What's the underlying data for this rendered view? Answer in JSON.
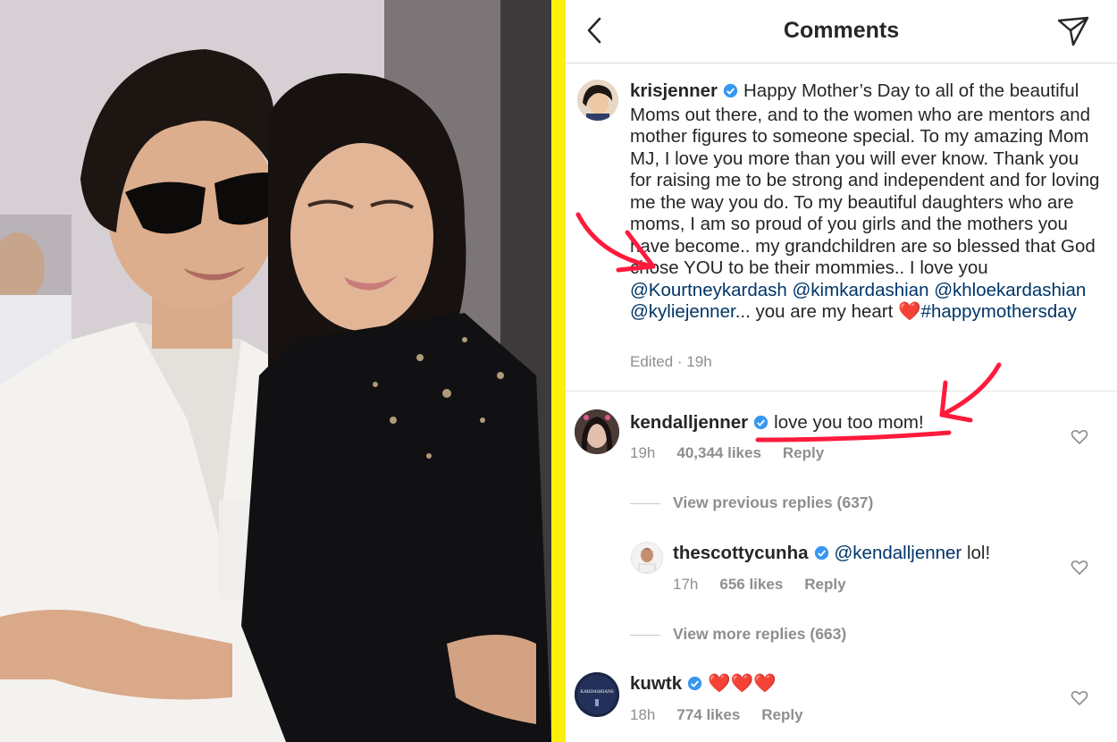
{
  "header": {
    "title": "Comments"
  },
  "caption": {
    "username": "krisjenner",
    "text_before_links": "Happy Mother’s Day to all of the beautiful Moms out there, and to the women who are mentors and mother figures to someone special. To my amazing Mom MJ, I love you more than you will ever know. Thank you for raising me to be strong and independent and for loving me the way you do. To my beautiful daughters who are moms, I am so proud of you girls and the mothers you have become.. my grandchildren are so blessed that God chose YOU to be their mommies.. I love you",
    "mentions": [
      "@Kourtneykardash",
      "@kimkardashian",
      "@khloekardashian",
      "@kyliejenner"
    ],
    "ellipsis": "...",
    "text_after_links": "you are my heart",
    "emoji": "❤️",
    "hashtag": "#happymothersday",
    "edited": "Edited · 19h"
  },
  "comments": [
    {
      "username": "kendalljenner",
      "text": "love you too mom!",
      "time": "19h",
      "likes": "40,344 likes",
      "reply": "Reply"
    }
  ],
  "view_previous_replies": "View previous replies (637)",
  "reply_comment": {
    "username": "thescottycunha",
    "mention": "@kendalljenner",
    "text": "lol!",
    "time": "17h",
    "likes": "656 likes",
    "reply": "Reply"
  },
  "view_more_replies": "View more replies (663)",
  "last_comment": {
    "username": "kuwtk",
    "text": "❤️❤️❤️",
    "time": "18h",
    "likes": "774 likes",
    "reply": "Reply",
    "avatar_label": "KARDASHIANS"
  },
  "colors": {
    "divider": "#fbf00a",
    "verified": "#3897f0",
    "link": "#003569",
    "annotation": "#ff1a3c",
    "muted": "#8e8e8e"
  }
}
